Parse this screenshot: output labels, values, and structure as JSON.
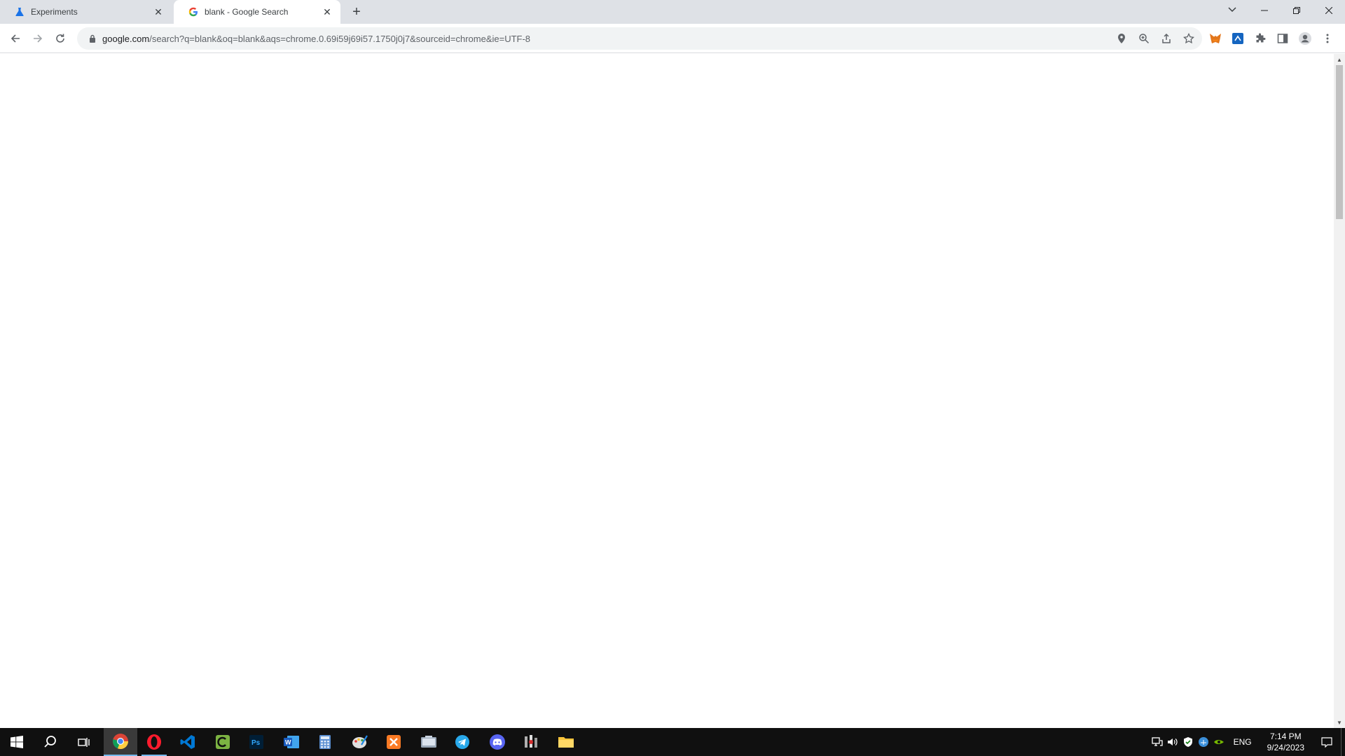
{
  "browser": {
    "tabs": [
      {
        "title": "Experiments",
        "icon": "flask-icon",
        "active": false
      },
      {
        "title": "blank - Google Search",
        "icon": "google-g-icon",
        "active": true
      }
    ],
    "url_host": "google.com",
    "url_rest": "/search?q=blank&oq=blank&aqs=chrome.0.69i59j69i57.1750j0j7&sourceid=chrome&ie=UTF-8"
  },
  "taskbar": {
    "apps": [
      "chrome-icon",
      "opera-icon",
      "vscode-icon",
      "camtasia-icon",
      "photoshop-icon",
      "word-icon",
      "calculator-icon",
      "paint-icon",
      "xampp-icon",
      "file-explorer-icon",
      "telegram-icon",
      "discord-icon",
      "media-app-icon",
      "folder-icon"
    ],
    "language": "ENG",
    "time": "7:14 PM",
    "date": "9/24/2023"
  }
}
